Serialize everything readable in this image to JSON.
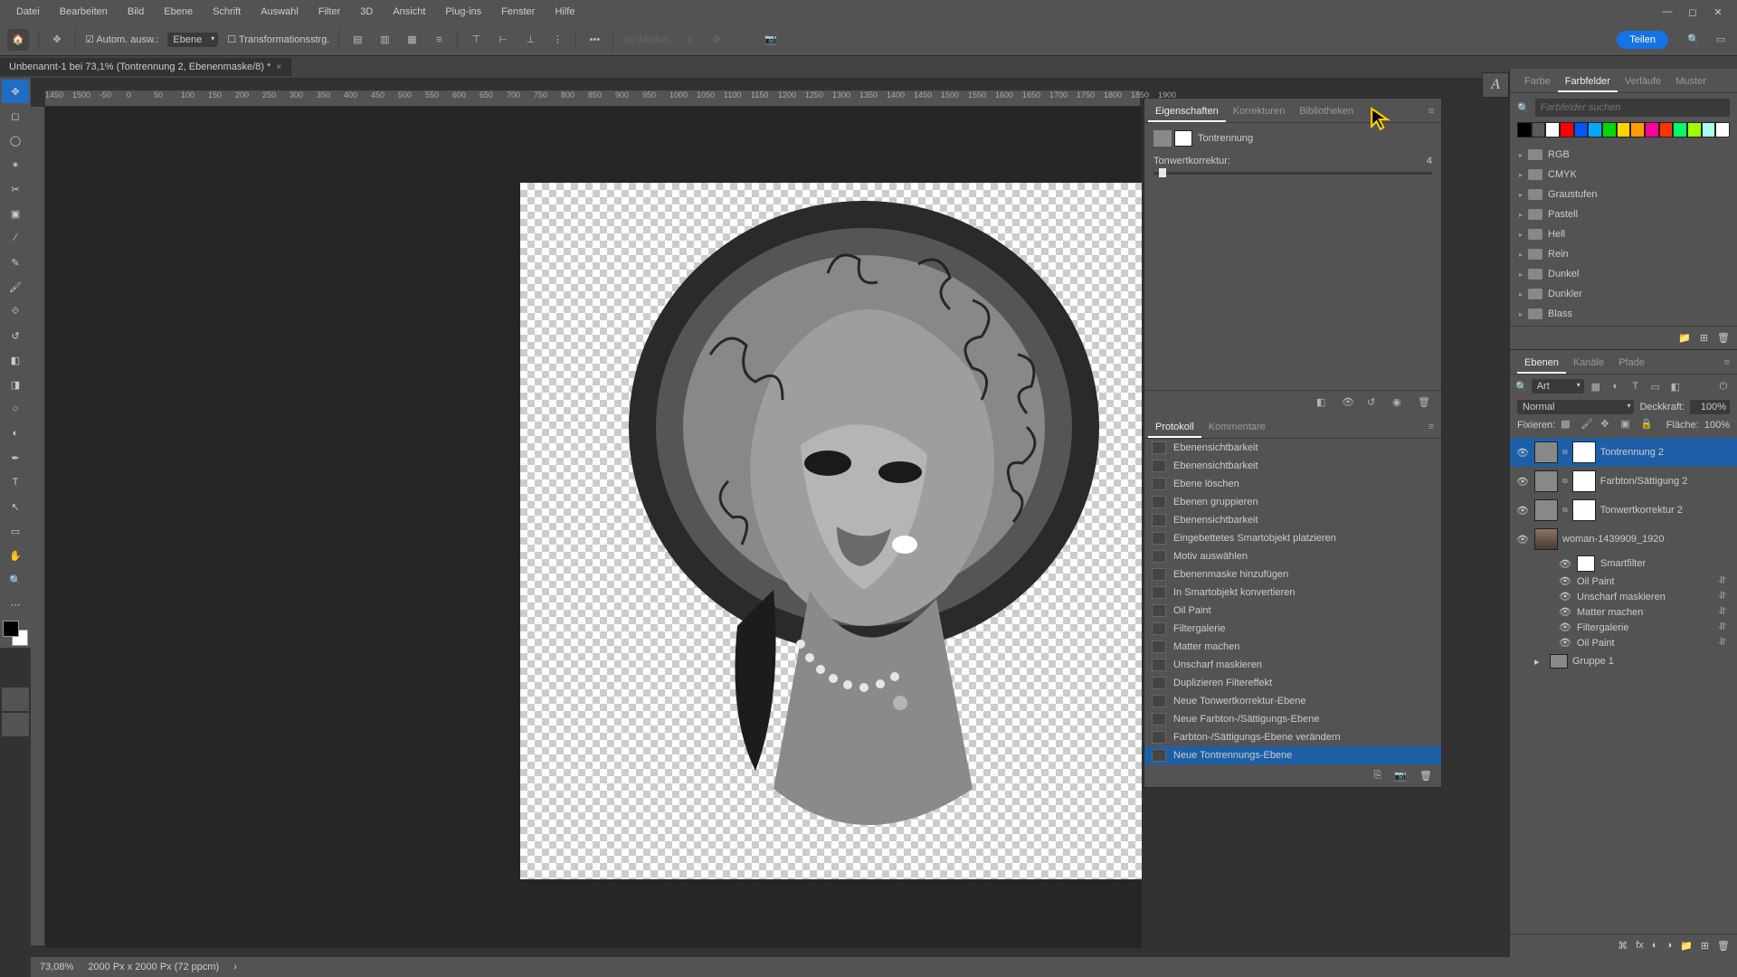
{
  "menu": {
    "items": [
      "Datei",
      "Bearbeiten",
      "Bild",
      "Ebene",
      "Schrift",
      "Auswahl",
      "Filter",
      "3D",
      "Ansicht",
      "Plug-ins",
      "Fenster",
      "Hilfe"
    ]
  },
  "optbar": {
    "auto_select": "Autom. ausw.:",
    "auto_select_target": "Ebene",
    "transform": "Transformationsstrg.",
    "mode3d": "3D-Modus:",
    "share": "Teilen"
  },
  "doc_tab": "Unbenannt-1 bei 73,1% (Tontrennung 2, Ebenenmaske/8) *",
  "ruler_ticks": [
    "1450",
    "1500",
    "-50",
    "0",
    "50",
    "100",
    "150",
    "200",
    "250",
    "300",
    "350",
    "400",
    "450",
    "500",
    "550",
    "600",
    "650",
    "700",
    "750",
    "800",
    "850",
    "900",
    "950",
    "1000",
    "1050",
    "1100",
    "1150",
    "1200",
    "1250",
    "1300",
    "1350",
    "1400",
    "1450",
    "1500",
    "1550",
    "1600",
    "1650",
    "1700",
    "1750",
    "1800",
    "1850",
    "1900"
  ],
  "status": {
    "zoom": "73,08%",
    "size": "2000 Px x 2000 Px (72 ppcm)"
  },
  "properties": {
    "tabs": [
      "Eigenschaften",
      "Korrekturen",
      "Bibliotheken"
    ],
    "type": "Tontrennung",
    "slider_label": "Tonwertkorrektur:",
    "slider_value": "4"
  },
  "history": {
    "tabs": [
      "Protokoll",
      "Kommentare"
    ],
    "items": [
      "Ebenensichtbarkeit",
      "Ebenensichtbarkeit",
      "Ebene löschen",
      "Ebenen gruppieren",
      "Ebenensichtbarkeit",
      "Eingebettetes Smartobjekt platzieren",
      "Motiv auswählen",
      "Ebenenmaske hinzufügen",
      "In Smartobjekt konvertieren",
      "Oil Paint",
      "Filtergalerie",
      "Matter machen",
      "Unscharf maskieren",
      "Duplizieren Filtereffekt",
      "Neue Tonwertkorrektur-Ebene",
      "Neue Farbton-/Sättigungs-Ebene",
      "Farbton-/Sättigungs-Ebene verändern",
      "Neue Tontrennungs-Ebene"
    ]
  },
  "swatches": {
    "tabs": [
      "Farbe",
      "Farbfelder",
      "Verläufe",
      "Muster"
    ],
    "search_placeholder": "Farbfelder suchen",
    "colors": [
      "#000000",
      "#5a5a5a",
      "#ffffff",
      "#ff0000",
      "#0055ff",
      "#00a8ff",
      "#00d900",
      "#ffd400",
      "#ff9c00",
      "#ff0099",
      "#ff3300",
      "#00ff66",
      "#9dff00",
      "#aaffee",
      "#ffffff"
    ],
    "folders": [
      "RGB",
      "CMYK",
      "Graustufen",
      "Pastell",
      "Hell",
      "Rein",
      "Dunkel",
      "Dunkler",
      "Blass"
    ]
  },
  "layers": {
    "tabs": [
      "Ebenen",
      "Kanäle",
      "Pfade"
    ],
    "filter_kind": "Art",
    "blend": "Normal",
    "opacity_label": "Deckkraft:",
    "opacity": "100%",
    "lock_label": "Fixieren:",
    "fill_label": "Fläche:",
    "fill": "100%",
    "rows": [
      {
        "name": "Tontrennung 2",
        "sel": true,
        "eye": true,
        "adj": true
      },
      {
        "name": "Farbton/Sättigung 2",
        "sel": false,
        "eye": true,
        "adj": true
      },
      {
        "name": "Tonwertkorrektur 2",
        "sel": false,
        "eye": true,
        "adj": true
      },
      {
        "name": "woman-1439909_1920",
        "sel": false,
        "eye": true,
        "adj": false,
        "so": true
      }
    ],
    "smartfilter_label": "Smartfilter",
    "filters": [
      "Oil Paint",
      "Unscharf maskieren",
      "Matter machen",
      "Filtergalerie",
      "Oil Paint"
    ],
    "group": "Gruppe 1"
  }
}
